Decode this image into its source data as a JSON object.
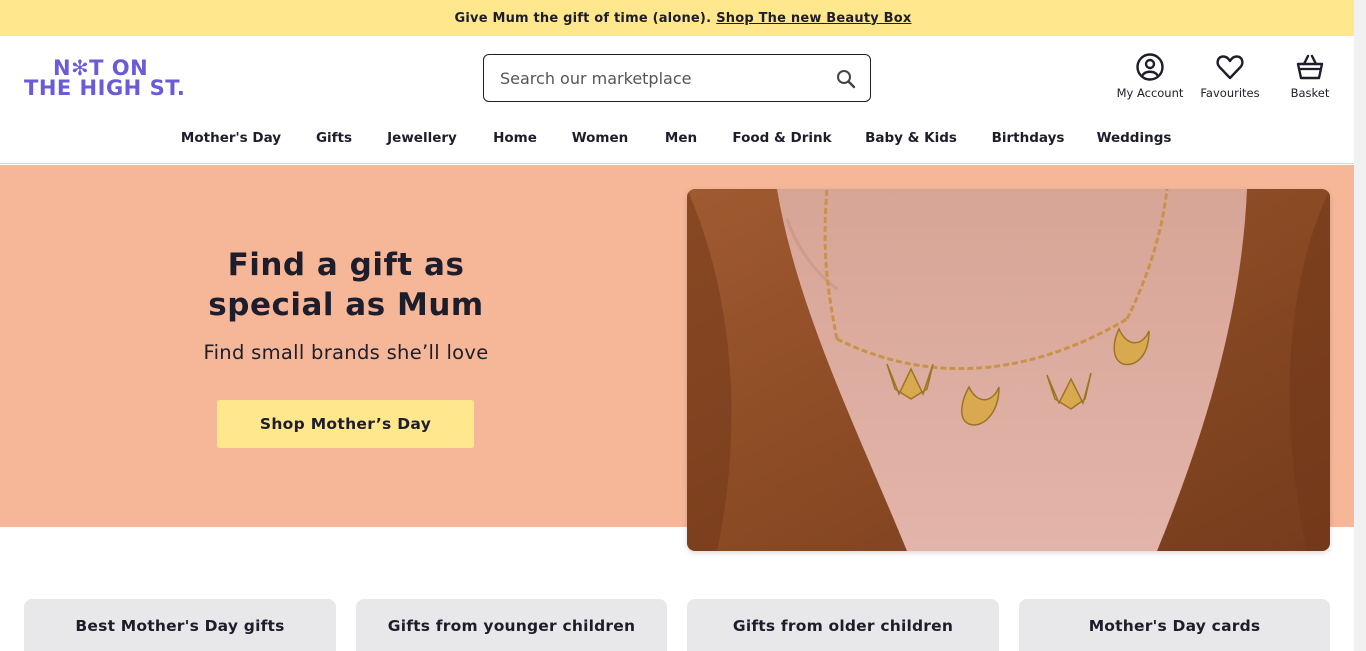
{
  "promo": {
    "text": "Give Mum the gift of time (alone).",
    "link": "Shop The new Beauty Box"
  },
  "logo": {
    "line1": "N✻T ON",
    "line2": "THE HIGH ST."
  },
  "search": {
    "placeholder": "Search our marketplace",
    "value": ""
  },
  "utilities": [
    {
      "label": "My Account",
      "icon": "account-icon"
    },
    {
      "label": "Favourites",
      "icon": "heart-icon"
    },
    {
      "label": "Basket",
      "icon": "basket-icon"
    }
  ],
  "nav": [
    "Mother's Day",
    "Gifts",
    "Jewellery",
    "Home",
    "Women",
    "Men",
    "Food & Drink",
    "Baby & Kids",
    "Birthdays",
    "Weddings"
  ],
  "hero": {
    "title_line1": "Find a gift as",
    "title_line2": "special as Mum",
    "subtitle": "Find small brands she’ll love",
    "cta": "Shop Mother’s Day",
    "image": "necklace-photo"
  },
  "categories": [
    "Best Mother's Day gifts",
    "Gifts from younger children",
    "Gifts from older children",
    "Mother's Day cards"
  ],
  "colors": {
    "promo_bg": "#fee78d",
    "brand": "#6a5bd6",
    "hero_bg": "#f6b799",
    "cta_bg": "#fee78d",
    "card_bg": "#e8e8ea"
  }
}
